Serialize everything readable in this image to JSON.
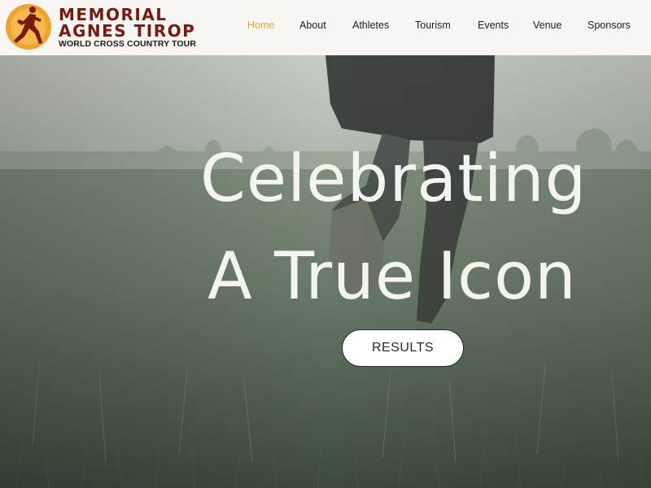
{
  "header": {
    "logo": {
      "line1": "MEMORIAL",
      "line2": "AGNES TIROP",
      "line3": "WORLD CROSS COUNTRY TOUR",
      "icon": "runner-logo-icon"
    },
    "nav": [
      {
        "label": "Home",
        "active": true
      },
      {
        "label": "About",
        "active": false
      },
      {
        "label": "Athletes",
        "active": false
      },
      {
        "label": "Tourism",
        "active": false
      },
      {
        "label": "Events",
        "active": false
      },
      {
        "label": "Venue",
        "active": false
      },
      {
        "label": "Sponsors",
        "active": false
      }
    ]
  },
  "hero": {
    "headline_line1": "Celebrating",
    "headline_line2": "A True Icon",
    "cta_label": "RESULTS"
  },
  "colors": {
    "accent": "#e4a635",
    "brand": "#7a1912",
    "header_bg": "#f7f6f2",
    "nav_text": "#1d1d1d"
  }
}
